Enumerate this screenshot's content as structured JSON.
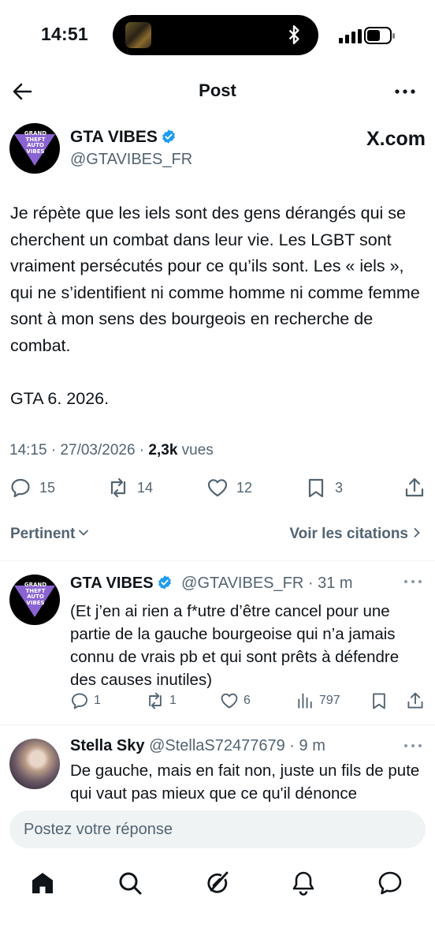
{
  "status_bar": {
    "time": "14:51"
  },
  "header": {
    "title": "Post"
  },
  "post": {
    "author_name": "GTA VIBES",
    "author_handle": "@GTAVIBES_FR",
    "avatar_text": "GRAND THEFT AUTO VIBES",
    "source_site": "X.com",
    "body": "Je répète que les iels sont des gens dérangés qui se cherchent un combat dans leur vie. Les LGBT sont vraiment persécutés pour ce qu’ils sont. Les « iels », qui ne s’identifient ni comme homme ni comme femme sont à mon sens des bourgeois en recherche de combat.\n\nGTA 6. 2026.",
    "timestamp": "14:15 · 27/03/2026 · ",
    "views_count": "2,3k",
    "views_label": " vues",
    "replies": "15",
    "reposts": "14",
    "likes": "12",
    "bookmarks": "3"
  },
  "sort": {
    "left_label": "Pertinent",
    "right_label": "Voir les citations"
  },
  "replies": [
    {
      "name": "GTA VIBES",
      "handle": "@GTAVIBES_FR",
      "time": " · 31 m",
      "text": "(Et j’en ai rien a f*utre d’être cancel pour une partie de la gauche bourgeoise qui n’a jamais connu de vrais pb et qui sont prêts à défendre des causes inutiles)",
      "replies": "1",
      "reposts": "1",
      "likes": "6",
      "views": "797"
    },
    {
      "name": "Stella Sky",
      "handle": "@StellaS72477679",
      "time": " · 9 m",
      "text": "De gauche, mais en fait non, juste un fils de pute qui vaut pas mieux que ce qu'il dénonce"
    }
  ],
  "compose": {
    "placeholder": "Postez votre réponse"
  },
  "colors": {
    "accent": "#1d9bf0",
    "secondary_text": "#536471",
    "text": "#0f1419"
  },
  "tabs": [
    "home-icon",
    "search-icon",
    "grok-icon",
    "notifications-icon",
    "messages-icon"
  ]
}
